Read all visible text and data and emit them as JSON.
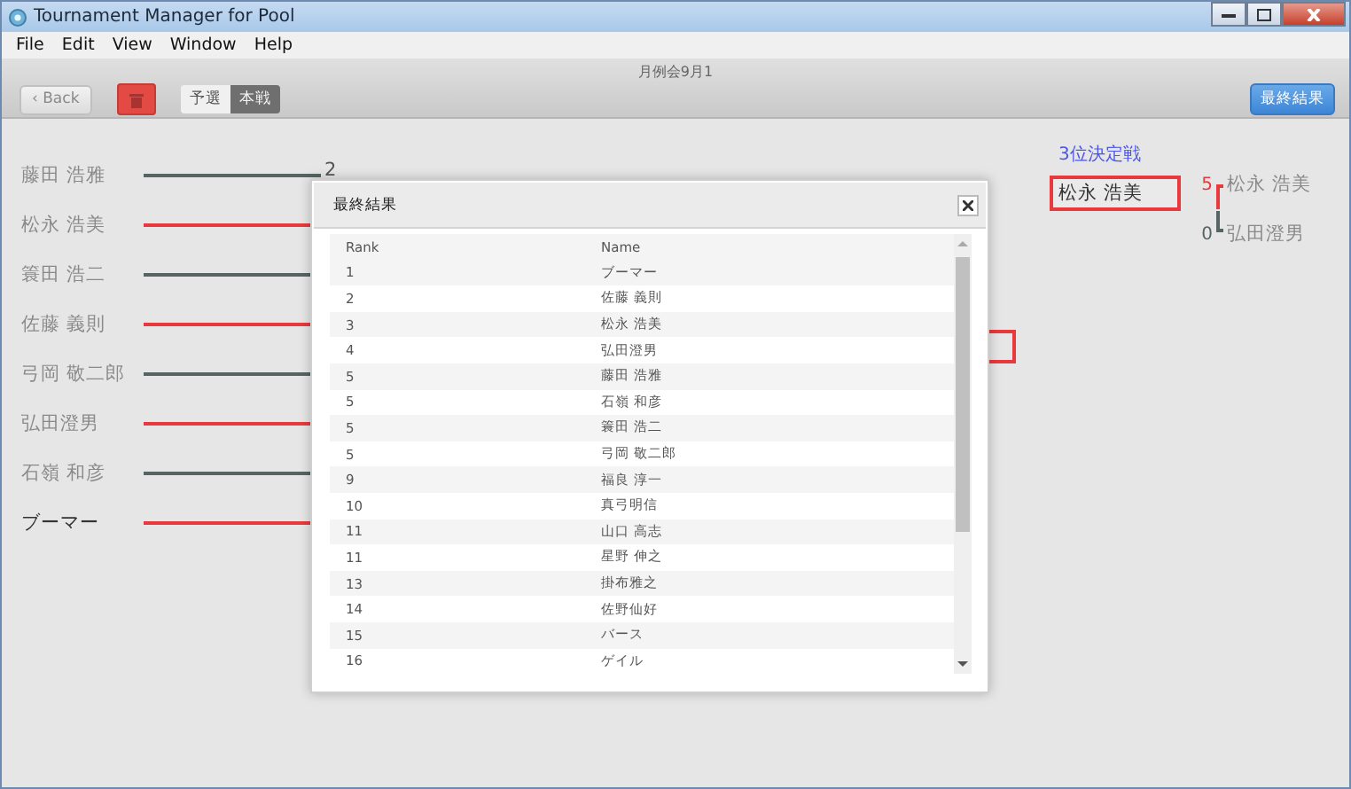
{
  "window": {
    "title": "Tournament Manager for Pool"
  },
  "menu": [
    "File",
    "Edit",
    "View",
    "Window",
    "Help"
  ],
  "subtitle": "月例会9月1",
  "toolbar": {
    "back_button": "‹ Back",
    "phase_tabs": [
      {
        "label": "予選",
        "selected": false
      },
      {
        "label": "本戦",
        "selected": true
      }
    ],
    "final_results_button": "最終結果"
  },
  "bracket": {
    "players": [
      {
        "name": "藤田 浩雅",
        "winner": false,
        "champion": false,
        "score": "2"
      },
      {
        "name": "松永 浩美",
        "winner": true,
        "champion": false
      },
      {
        "name": "簑田 浩二",
        "winner": false,
        "champion": false
      },
      {
        "name": "佐藤 義則",
        "winner": true,
        "champion": false
      },
      {
        "name": "弓岡 敬二郎",
        "winner": false,
        "champion": false
      },
      {
        "name": "弘田澄男",
        "winner": true,
        "champion": false
      },
      {
        "name": "石嶺 和彦",
        "winner": false,
        "champion": false
      },
      {
        "name": "ブーマー",
        "winner": true,
        "champion": true
      }
    ]
  },
  "third_place": {
    "title": "3位決定戦",
    "result": "松永 浩美",
    "entrants": [
      {
        "score": "5",
        "name": "松永 浩美",
        "winner": true
      },
      {
        "score": "0",
        "name": "弘田澄男",
        "winner": false
      }
    ]
  },
  "dialog": {
    "title": "最終結果",
    "columns": [
      "Rank",
      "Name"
    ],
    "rows": [
      {
        "rank": "1",
        "name": "ブーマー"
      },
      {
        "rank": "2",
        "name": "佐藤 義則"
      },
      {
        "rank": "3",
        "name": "松永 浩美"
      },
      {
        "rank": "4",
        "name": "弘田澄男"
      },
      {
        "rank": "5",
        "name": "藤田 浩雅"
      },
      {
        "rank": "5",
        "name": "石嶺 和彦"
      },
      {
        "rank": "5",
        "name": "簑田 浩二"
      },
      {
        "rank": "5",
        "name": "弓岡 敬二郎"
      },
      {
        "rank": "9",
        "name": "福良 淳一"
      },
      {
        "rank": "10",
        "name": "真弓明信"
      },
      {
        "rank": "11",
        "name": "山口 高志"
      },
      {
        "rank": "11",
        "name": "星野 伸之"
      },
      {
        "rank": "13",
        "name": "掛布雅之"
      },
      {
        "rank": "14",
        "name": "佐野仙好"
      },
      {
        "rank": "15",
        "name": "バース"
      },
      {
        "rank": "16",
        "name": "ゲイル"
      }
    ]
  }
}
